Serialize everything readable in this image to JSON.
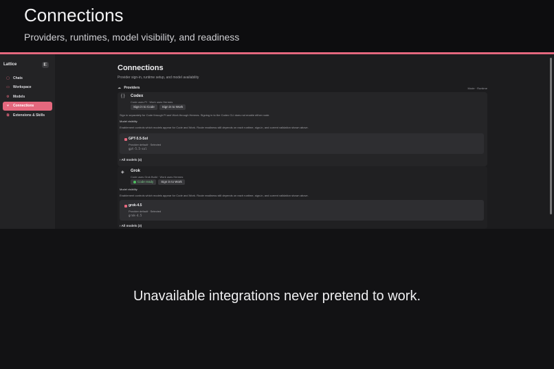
{
  "hero": {
    "title": "Connections",
    "subtitle": "Providers, runtimes, model visibility, and readiness"
  },
  "sidebar": {
    "brand": "Lattice",
    "collapse_icon": "sidebar-toggle-icon",
    "items": [
      {
        "label": "Chats",
        "icon": "chat-icon"
      },
      {
        "label": "Workspace",
        "icon": "folder-icon"
      },
      {
        "label": "Models",
        "icon": "gear-icon"
      },
      {
        "label": "Connections",
        "icon": "plug-icon",
        "active": true
      },
      {
        "label": "Extensions & Skills",
        "icon": "puzzle-icon"
      }
    ]
  },
  "page": {
    "title": "Connections",
    "subtitle": "Provider sign-in, runtime setup, and model availability"
  },
  "providers_section": {
    "label": "Providers",
    "mode_label": "Mode · Runtime"
  },
  "providers": [
    {
      "icon": "braces-icon",
      "name": "Codex",
      "detail": "Code uses Pi · Work uses Hermes",
      "buttons": [
        "Sign in to Code",
        "Sign in to Work"
      ],
      "note": "Sign in separately for Code through Pi and Work through Hermes. Signing in to the Codex CLI does not enable either route.",
      "visibility_label": "Model visibility",
      "visibility_desc": "Enablement controls which models appear for Code and Work. Route readiness still depends on each runtime, sign-in, and current validation shown above.",
      "model": {
        "name": "GPT-5.5-Sol",
        "state": "Provider default · Selected",
        "id": "gpt-5.5-sol"
      },
      "all_models": "All models (4)"
    },
    {
      "icon": "grok-icon",
      "name": "Grok",
      "detail": "Code uses Grok Build · Work uses Hermes",
      "status": "Code ready",
      "buttons": [
        "Sign in to Work"
      ],
      "visibility_label": "Model visibility",
      "visibility_desc": "Enablement controls which models appear for Code and Work. Route readiness still depends on each runtime, sign-in, and current validation shown above.",
      "model": {
        "name": "grok-4.5",
        "state": "Provider default · Selected",
        "id": "grok-4.5"
      },
      "all_models": "All models (3)"
    }
  ],
  "tagline": "Unavailable integrations never pretend to work.",
  "colors": {
    "accent": "#e5687e",
    "background": "#121214",
    "ready": "#4cc15f"
  }
}
